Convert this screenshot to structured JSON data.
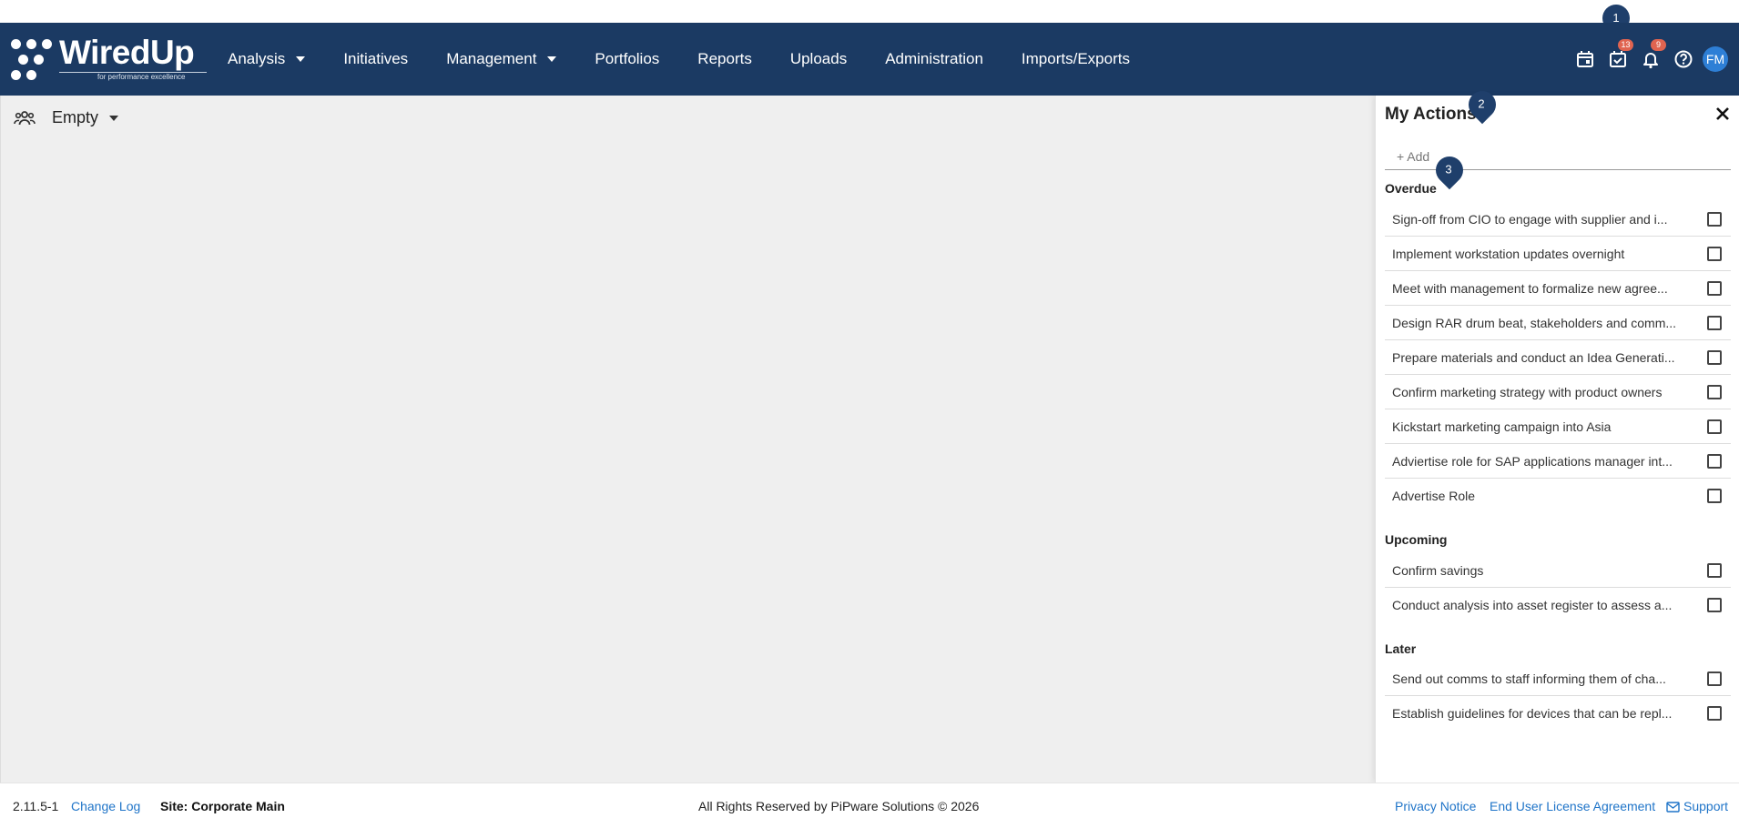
{
  "brand": {
    "name": "WiredUp",
    "tagline": "for performance excellence"
  },
  "nav": {
    "items": [
      {
        "label": "Analysis",
        "dropdown": true
      },
      {
        "label": "Initiatives",
        "dropdown": false
      },
      {
        "label": "Management",
        "dropdown": true
      },
      {
        "label": "Portfolios",
        "dropdown": false
      },
      {
        "label": "Reports",
        "dropdown": false
      },
      {
        "label": "Uploads",
        "dropdown": false
      },
      {
        "label": "Administration",
        "dropdown": false
      },
      {
        "label": "Imports/Exports",
        "dropdown": false
      }
    ]
  },
  "header_icons": {
    "actions_badge": "13",
    "notifications_badge": "9",
    "avatar_initials": "FM"
  },
  "tour": {
    "step1": "1",
    "step2": "2",
    "step3": "3"
  },
  "main": {
    "team_selector": "Empty"
  },
  "panel": {
    "title": "My Actions",
    "add_placeholder": "+ Add",
    "overdue": {
      "title": "Overdue",
      "items": [
        "Sign-off from CIO to engage with supplier and i...",
        "Implement workstation updates overnight",
        "Meet with management to formalize new agree...",
        "Design RAR drum beat, stakeholders and comm...",
        "Prepare materials and conduct an Idea Generati...",
        "Confirm marketing strategy with product owners",
        "Kickstart marketing campaign into Asia",
        "Adviertise role for SAP applications manager int...",
        "Advertise Role"
      ]
    },
    "upcoming": {
      "title": "Upcoming",
      "items": [
        "Confirm savings",
        "Conduct analysis into asset register to assess a..."
      ]
    },
    "later": {
      "title": "Later",
      "items": [
        "Send out comms to staff informing them of cha...",
        "Establish guidelines for devices that can be repl..."
      ]
    }
  },
  "footer": {
    "version": "2.11.5-1",
    "change_log": "Change Log",
    "site": "Site: Corporate Main",
    "copyright": "All Rights Reserved by PiPware Solutions © 2026",
    "privacy": "Privacy Notice",
    "eula": "End User License Agreement",
    "support": "Support"
  },
  "colors": {
    "nav_bg": "#1b3a63",
    "accent": "#1f74c8",
    "badge": "#e06450",
    "avatar": "#2e7fd6"
  }
}
